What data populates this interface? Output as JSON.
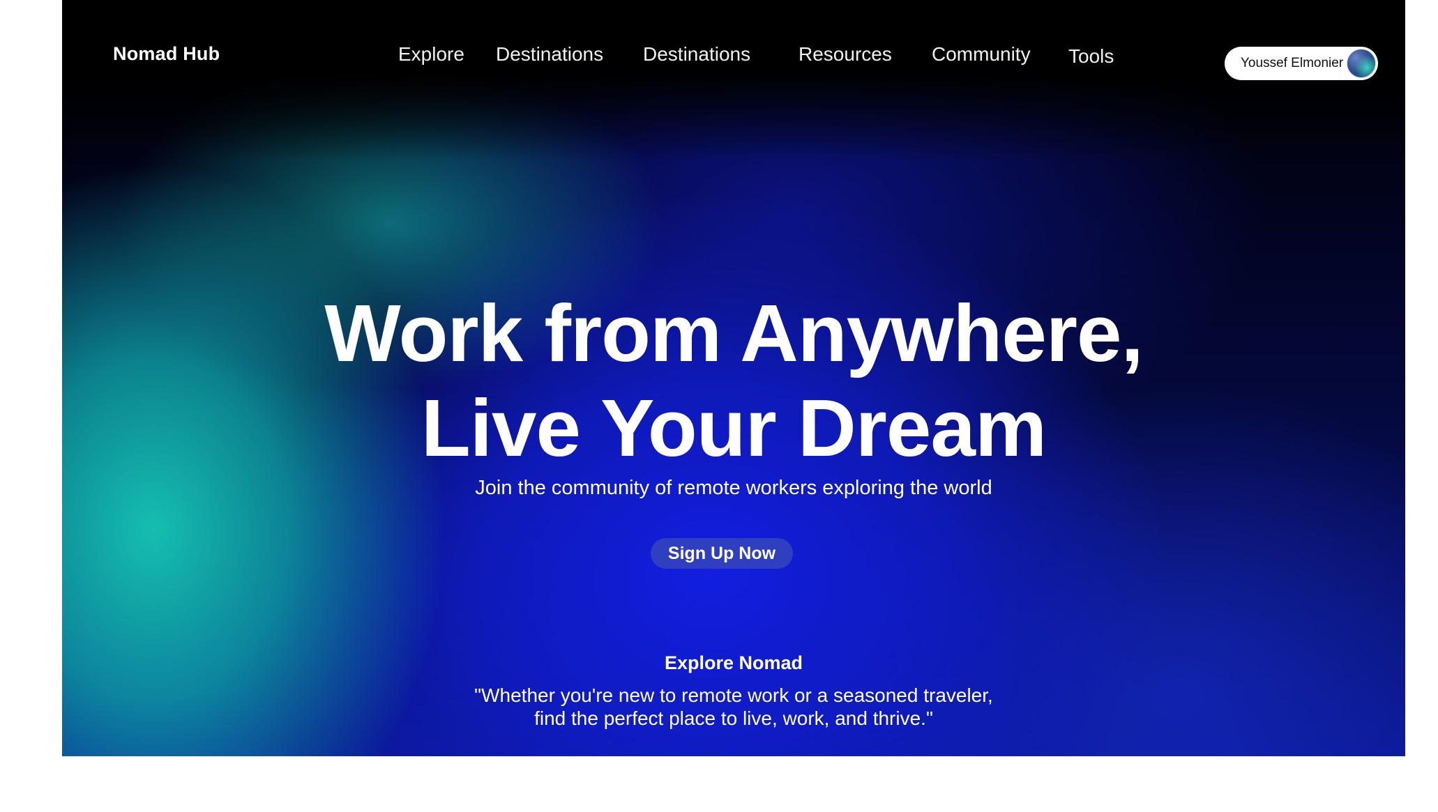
{
  "header": {
    "brand": "Nomad Hub",
    "nav": [
      {
        "label": "Explore"
      },
      {
        "label": "Destinations"
      },
      {
        "label": "Destinations"
      },
      {
        "label": "Resources"
      },
      {
        "label": "Community"
      },
      {
        "label": "Tools"
      }
    ],
    "user": {
      "name": "Youssef Elmonier",
      "avatar_icon": "user-avatar"
    }
  },
  "hero": {
    "headline_line1": "Work from Anywhere,",
    "headline_line2": "Live Your Dream",
    "subtitle": "Join the community of remote workers exploring the world",
    "cta_label": "Sign Up Now"
  },
  "explore": {
    "title": "Explore Nomad",
    "quote_line1": "\"Whether you're new to remote work or a seasoned traveler,",
    "quote_line2": "find the perfect place to live, work, and thrive.\""
  },
  "colors": {
    "accent_teal": "#16c8b4",
    "accent_blue": "#121ee1",
    "cta_background": "#2f3fbf",
    "nav_background": "#000000"
  }
}
